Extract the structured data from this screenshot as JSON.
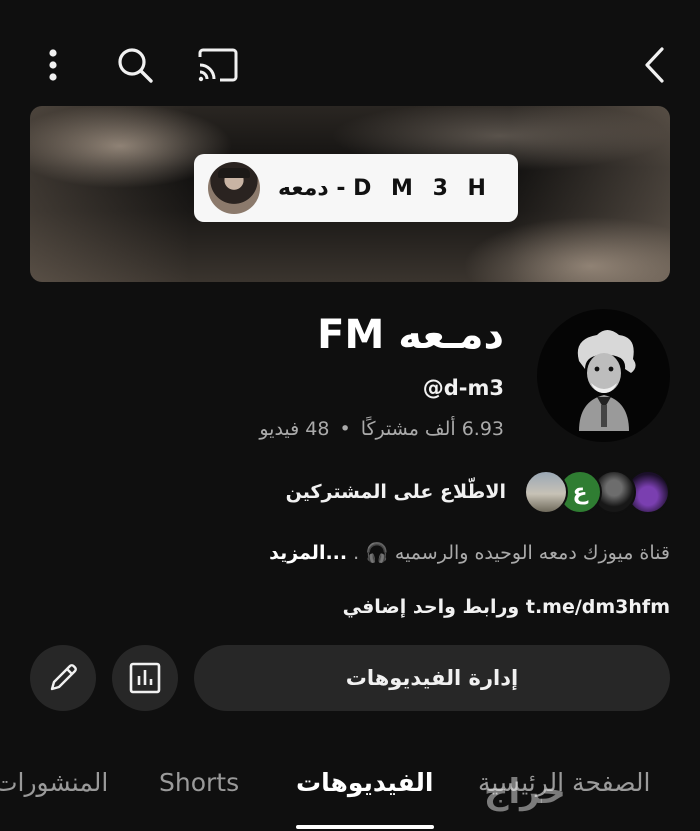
{
  "topbar": {
    "icons": [
      "more-vertical-icon",
      "search-icon",
      "cast-icon",
      "back-arrow-icon"
    ]
  },
  "banner": {
    "text": "دمعه - D M 3 H"
  },
  "channel": {
    "name": "دمـعه FM",
    "handle": "@d-m3",
    "subscribers": "6.93 ألف مشتركًا",
    "separator": "•",
    "videos": "48 فيديو"
  },
  "subscribers_row": {
    "label": "الاطّلاع على المشتركين",
    "avatar_letter": "ع"
  },
  "description": {
    "text": "قناة ميوزك دمعه الوحيده والرسميه 🎧 .",
    "more": "...المزيد"
  },
  "links": {
    "text": "t.me/dm3hfm ورابط واحد إضافي"
  },
  "actions": {
    "manage_videos": "إدارة الفيديوهات"
  },
  "tabs": {
    "home": "الصفحة الرئيسية",
    "videos": "الفيديوهات",
    "shorts": "Shorts",
    "posts": "المنشورات"
  },
  "watermark": "حراج",
  "colors": {
    "background": "#0f0f0f",
    "button": "#272727",
    "secondary_text": "#aaaaaa"
  }
}
